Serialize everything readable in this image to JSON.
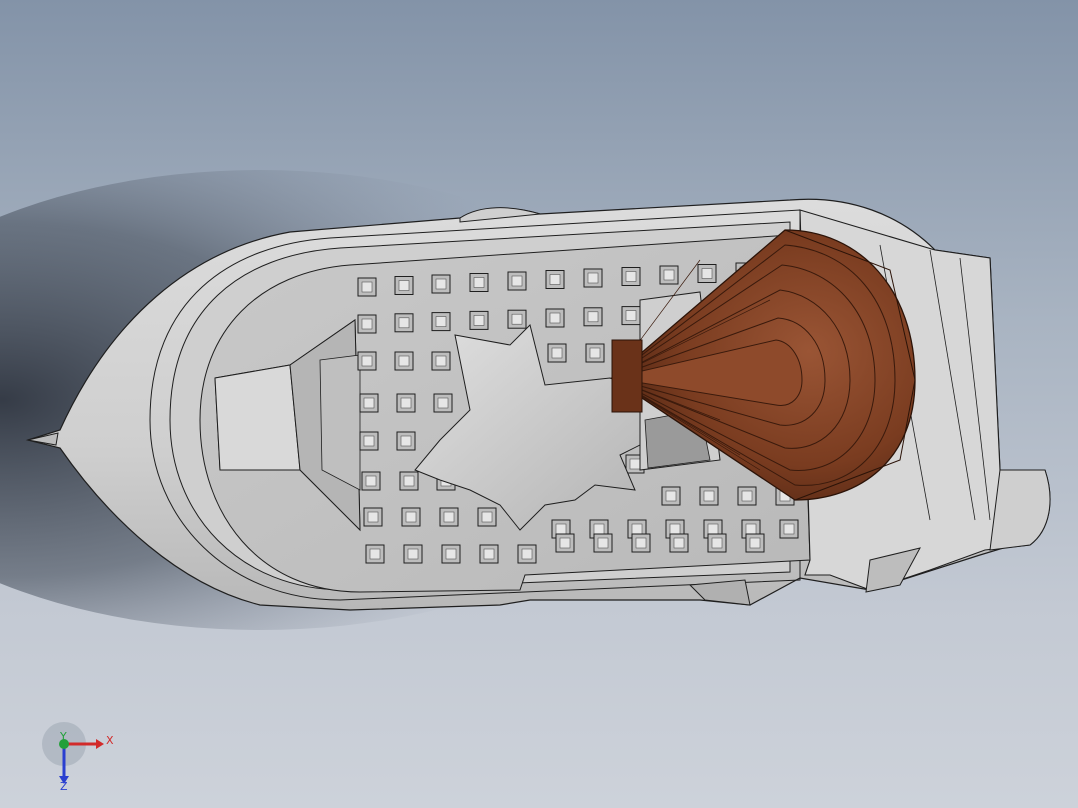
{
  "viewport": {
    "background_top": "#8393a8",
    "background_bottom": "#cdd2da"
  },
  "model": {
    "hull_color": "#d2d2d2",
    "deck_color": "#c4c4c4",
    "edge_color": "#1f1f1f",
    "highlight_part_color": "#7b3f23"
  },
  "triad": {
    "x_label": "X",
    "y_label": "Y",
    "z_label": "Z",
    "x_color": "#d22a2a",
    "y_color": "#23a03a",
    "z_color": "#2a3fd0"
  }
}
